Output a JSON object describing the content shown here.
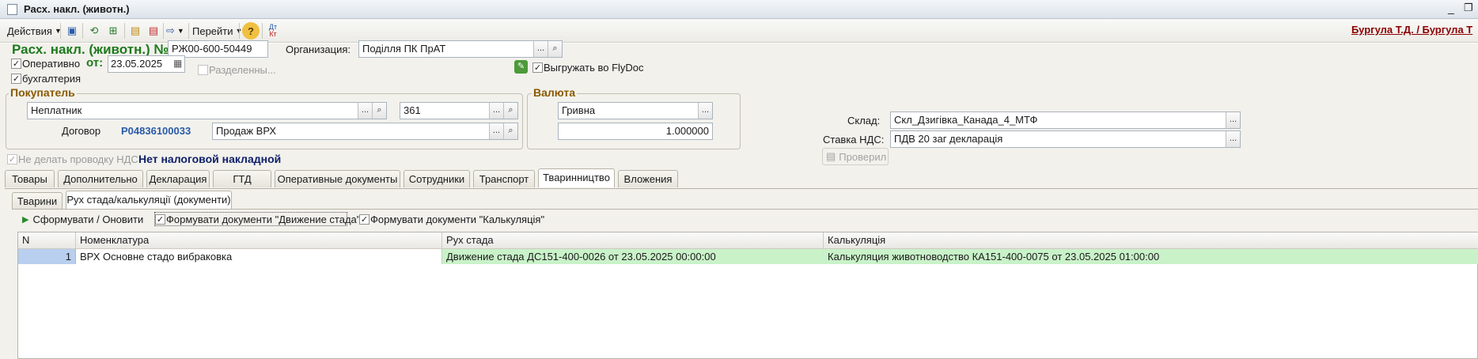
{
  "window": {
    "title": "Расх. накл. (животн.)"
  },
  "toolbar": {
    "actions_label": "Действия",
    "goto_label": "Перейти",
    "user_link": "Бургула Т.Д.  /  Бургула Т"
  },
  "header": {
    "doc_title": "Расх. накл. (животн.) №",
    "doc_number": "РЖ00-600-50449",
    "org_label": "Организация:",
    "org_value": "Поділля ПК ПрАТ",
    "operative_label": "Оперативно",
    "date_label": "от:",
    "date_value": "23.05.2025",
    "accounting_label": "бухгалтерия",
    "split_label": "Разделенны...",
    "flydoc_label": "Выгружать во FlyDoc"
  },
  "buyer": {
    "group_title": "Покупатель",
    "buyer_value": "Неплатник",
    "code_value": "361",
    "contract_label": "Договор",
    "contract_number": "P04836100033",
    "contract_value": "Продаж ВРХ"
  },
  "currency": {
    "group_title": "Валюта",
    "value": "Гривна",
    "rate": "1.000000"
  },
  "warehouse": {
    "label": "Склад:",
    "value": "Скл_Дзигівка_Канада_4_МТФ"
  },
  "vat": {
    "label": "Ставка НДС:",
    "value": "ПДВ 20 заг декларація",
    "no_vat_label": "Не делать проводку НДС",
    "no_invoice_label": "Нет налоговой накладной",
    "checked_button": "Проверил"
  },
  "tabs": [
    "Товары",
    "Дополнительно",
    "Декларация",
    "ГТД",
    "Оперативные документы",
    "Сотрудники",
    "Транспорт",
    "Тваринництво",
    "Вложения"
  ],
  "subtabs": [
    "Тварини",
    "Рух стада/калькуляції (документи)"
  ],
  "subpanel": {
    "form_button": "Сформувати / Оновити",
    "cb_movement_label": "Формувати документи \"Движение стада\"",
    "cb_calc_label": "Формувати документи \"Калькуляція\""
  },
  "table": {
    "columns": [
      "N",
      "Номенклатура",
      "Рух стада",
      "Калькуляція"
    ],
    "rows": [
      {
        "n": "1",
        "item": "ВРХ Основне стадо вибраковка",
        "movement": "Движение стада ДС151-400-0026 от 23.05.2025 00:00:00",
        "calc": "Калькуляция животноводство КА151-400-0075 от 23.05.2025 01:00:00"
      }
    ]
  },
  "colors": {
    "title_green": "#1d7a1d",
    "group_brown": "#8a5a00",
    "link_red": "#8b0000",
    "row_green": "#c9f2c9",
    "row_blue": "#b8cff0"
  }
}
